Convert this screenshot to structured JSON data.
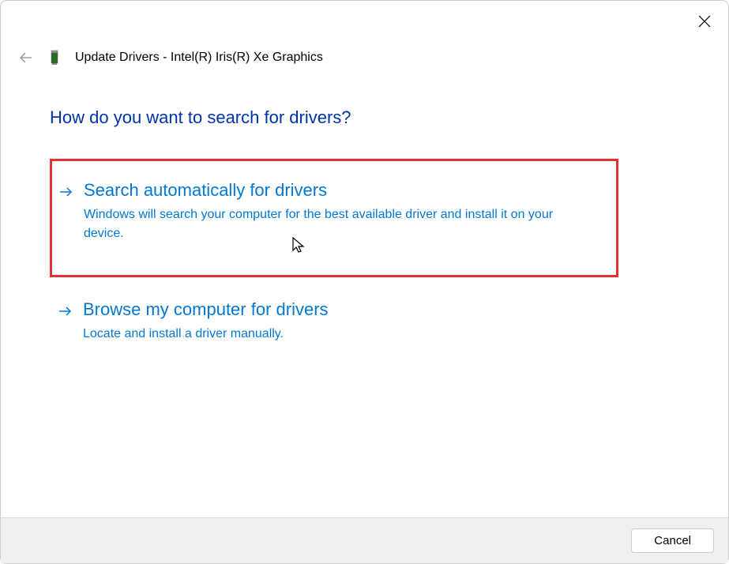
{
  "header": {
    "title": "Update Drivers - Intel(R) Iris(R) Xe Graphics"
  },
  "heading": "How do you want to search for drivers?",
  "options": [
    {
      "title": "Search automatically for drivers",
      "description": "Windows will search your computer for the best available driver and install it on your device."
    },
    {
      "title": "Browse my computer for drivers",
      "description": "Locate and install a driver manually."
    }
  ],
  "footer": {
    "cancel_label": "Cancel"
  }
}
